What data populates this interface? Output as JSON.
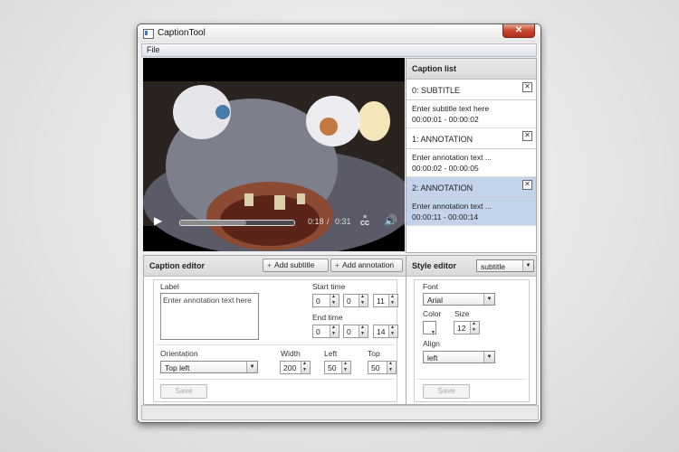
{
  "window": {
    "title": "CaptionTool",
    "close_symbol": "✕"
  },
  "menu": {
    "file": "File"
  },
  "video": {
    "play_symbol": "▶",
    "progress": 0.58,
    "current_time": "0:18",
    "separator": "/",
    "total_time": "0:31",
    "cc_label": "CC",
    "volume_symbol": "🔊"
  },
  "caption_list": {
    "title": "Caption list",
    "remove_symbol": "✕",
    "items": [
      {
        "title": "0: SUBTITLE",
        "text": "Enter subtitle text here",
        "time": "00:00:01 - 00:00:02"
      },
      {
        "title": "1: ANNOTATION",
        "text": "Enter annotation text ...",
        "time": "00:00:02 - 00:00:05"
      },
      {
        "title": "2: ANNOTATION",
        "text": "Enter annotation text ...",
        "time": "00:00:11 - 00:00:14"
      }
    ]
  },
  "caption_editor": {
    "title": "Caption editor",
    "add_subtitle": "Add subtitle",
    "add_annotation": "Add annotation",
    "plus_symbol": "+",
    "label_label": "Label",
    "label_value": "Enter annotation text here",
    "start_time_label": "Start time",
    "start_time": [
      "0",
      "0",
      "11"
    ],
    "end_time_label": "End time",
    "end_time": [
      "0",
      "0",
      "14"
    ],
    "orientation_label": "Orientation",
    "orientation_value": "Top left",
    "width_label": "Width",
    "width_value": "200",
    "left_label": "Left",
    "left_value": "50",
    "top_label": "Top",
    "top_value": "50",
    "save_label": "Save"
  },
  "style_editor": {
    "title": "Style editor",
    "style_select": "subtitle",
    "font_label": "Font",
    "font_value": "Arial",
    "color_label": "Color",
    "size_label": "Size",
    "size_value": "12",
    "align_label": "Align",
    "align_value": "left",
    "save_label": "Save"
  }
}
